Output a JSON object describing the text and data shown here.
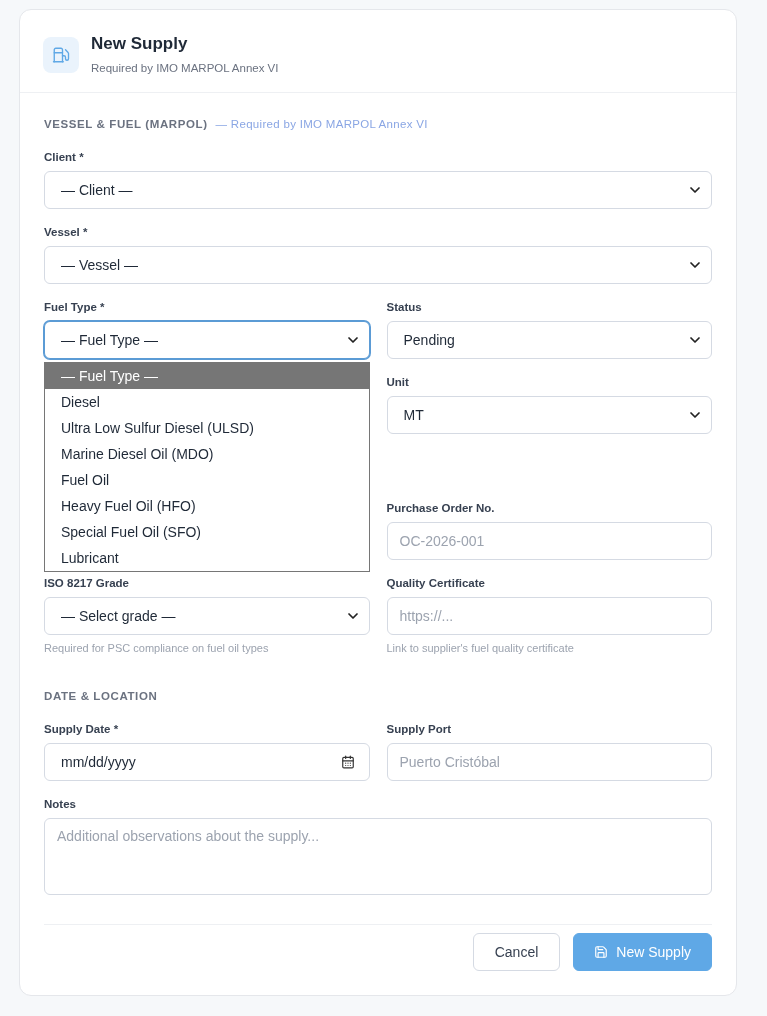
{
  "header": {
    "title": "New Supply",
    "subtitle": "Required by IMO MARPOL Annex VI"
  },
  "sections": [
    {
      "title": "VESSEL & FUEL (MARPOL)",
      "note": "— Required by IMO MARPOL Annex VI",
      "rows": [
        {
          "full": {
            "kind": "select",
            "label": "Client *",
            "value": "— Client —"
          }
        },
        {
          "full": {
            "kind": "select",
            "label": "Vessel *",
            "value": "— Vessel —"
          }
        },
        {
          "left": {
            "kind": "select",
            "label": "Fuel Type *",
            "value": "— Fuel Type —",
            "focused": true,
            "open": true,
            "options": [
              {
                "label": "— Fuel Type —",
                "selected": true
              },
              {
                "label": "Diesel",
                "selected": false
              },
              {
                "label": "Ultra Low Sulfur Diesel (ULSD)",
                "selected": false
              },
              {
                "label": "Marine Diesel Oil (MDO)",
                "selected": false
              },
              {
                "label": "Fuel Oil",
                "selected": false
              },
              {
                "label": "Heavy Fuel Oil (HFO)",
                "selected": false
              },
              {
                "label": "Special Fuel Oil (SFO)",
                "selected": false
              },
              {
                "label": "Lubricant",
                "selected": false
              }
            ]
          },
          "right": {
            "kind": "select",
            "label": "Status",
            "value": "Pending"
          }
        },
        {
          "right": {
            "kind": "select",
            "label": "Unit",
            "value": "MT"
          }
        }
      ]
    },
    {
      "rows": [
        {
          "right": {
            "kind": "input",
            "label": "Purchase Order No.",
            "placeholder": "OC-2026-001"
          }
        },
        {
          "left": {
            "kind": "select",
            "label": "ISO 8217 Grade",
            "value": "— Select grade —",
            "hint": "Required for PSC compliance on fuel oil types"
          },
          "right": {
            "kind": "input",
            "label": "Quality Certificate",
            "placeholder": "https://...",
            "hint": "Link to supplier's fuel quality certificate"
          }
        }
      ]
    },
    {
      "title": "DATE & LOCATION",
      "rows": [
        {
          "left": {
            "kind": "date",
            "label": "Supply Date *",
            "value": "mm/dd/yyyy"
          },
          "right": {
            "kind": "input",
            "label": "Supply Port",
            "placeholder": "Puerto Cristóbal"
          }
        },
        {
          "full": {
            "kind": "textarea",
            "label": "Notes",
            "placeholder": "Additional observations about the supply..."
          }
        }
      ]
    }
  ],
  "buttons": [
    {
      "kind": "secondary",
      "label": "Cancel"
    },
    {
      "kind": "primary",
      "label": "New Supply"
    }
  ]
}
